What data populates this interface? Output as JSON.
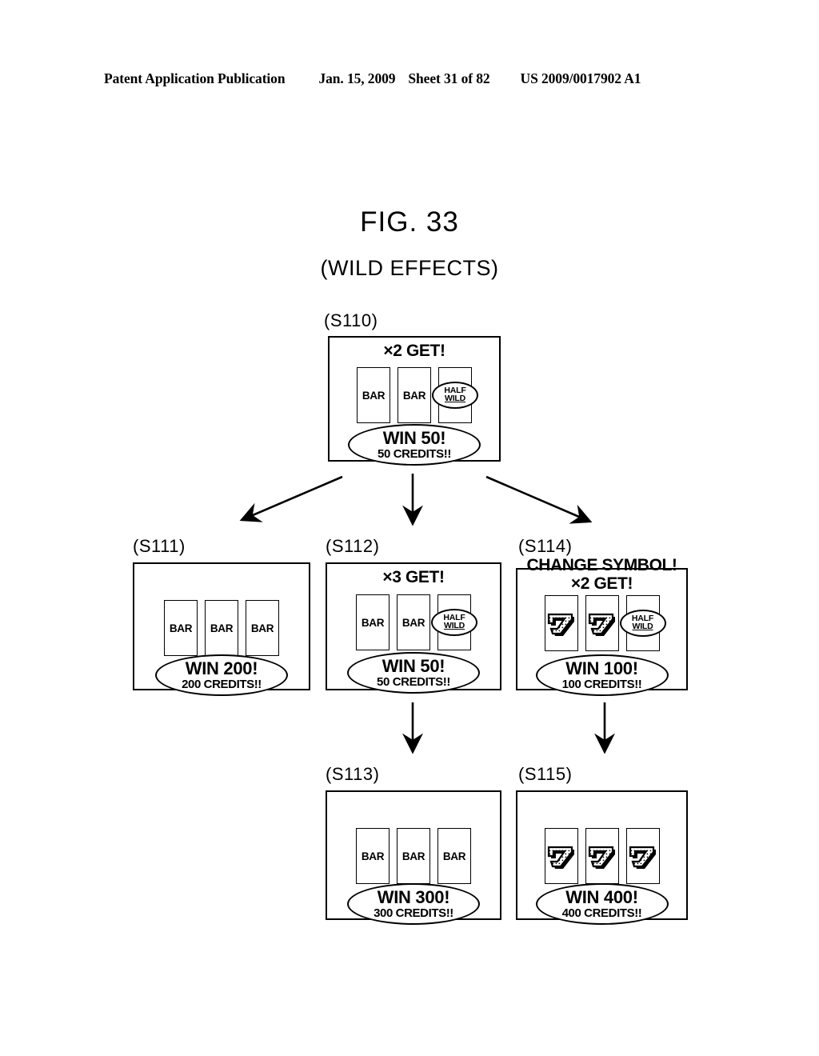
{
  "header": {
    "publication": "Patent Application Publication",
    "date": "Jan. 15, 2009",
    "sheet": "Sheet 31 of 82",
    "number": "US 2009/0017902 A1"
  },
  "figure": {
    "title": "FIG. 33",
    "subtitle": "(WILD EFFECTS)"
  },
  "colors": {
    "ink": "#000000",
    "paper": "#ffffff"
  },
  "panels": [
    {
      "step": "(S110)",
      "header_line1": "×2 GET!",
      "header_line2": "",
      "reels": [
        "BAR",
        "BAR",
        "HALF WILD"
      ],
      "win_main": "WIN 50!",
      "win_sub": "50 CREDITS!!"
    },
    {
      "step": "(S111)",
      "header_line1": "",
      "header_line2": "",
      "reels": [
        "BAR",
        "BAR",
        "BAR"
      ],
      "win_main": "WIN 200!",
      "win_sub": "200 CREDITS!!"
    },
    {
      "step": "(S112)",
      "header_line1": "×3 GET!",
      "header_line2": "",
      "reels": [
        "BAR",
        "BAR",
        "HALF WILD"
      ],
      "win_main": "WIN 50!",
      "win_sub": "50 CREDITS!!"
    },
    {
      "step": "(S114)",
      "header_line1": "CHANGE SYMBOL!",
      "header_line2": "×2 GET!",
      "reels": [
        "SEVEN",
        "SEVEN",
        "HALF WILD"
      ],
      "win_main": "WIN 100!",
      "win_sub": "100 CREDITS!!"
    },
    {
      "step": "(S113)",
      "header_line1": "",
      "header_line2": "",
      "reels": [
        "BAR",
        "BAR",
        "BAR"
      ],
      "win_main": "WIN 300!",
      "win_sub": "300 CREDITS!!"
    },
    {
      "step": "(S115)",
      "header_line1": "",
      "header_line2": "",
      "reels": [
        "SEVEN",
        "SEVEN",
        "SEVEN"
      ],
      "win_main": "WIN 400!",
      "win_sub": "400 CREDITS!!"
    }
  ],
  "symbols": {
    "halfwild_line1": "HALF",
    "halfwild_line2": "WILD"
  },
  "flow": {
    "arrows": [
      {
        "from": "(S110)",
        "to": "(S111)",
        "kind": "diagonal-left"
      },
      {
        "from": "(S110)",
        "to": "(S112)",
        "kind": "vertical"
      },
      {
        "from": "(S110)",
        "to": "(S114)",
        "kind": "diagonal-right"
      },
      {
        "from": "(S112)",
        "to": "(S113)",
        "kind": "vertical"
      },
      {
        "from": "(S114)",
        "to": "(S115)",
        "kind": "vertical"
      }
    ]
  }
}
